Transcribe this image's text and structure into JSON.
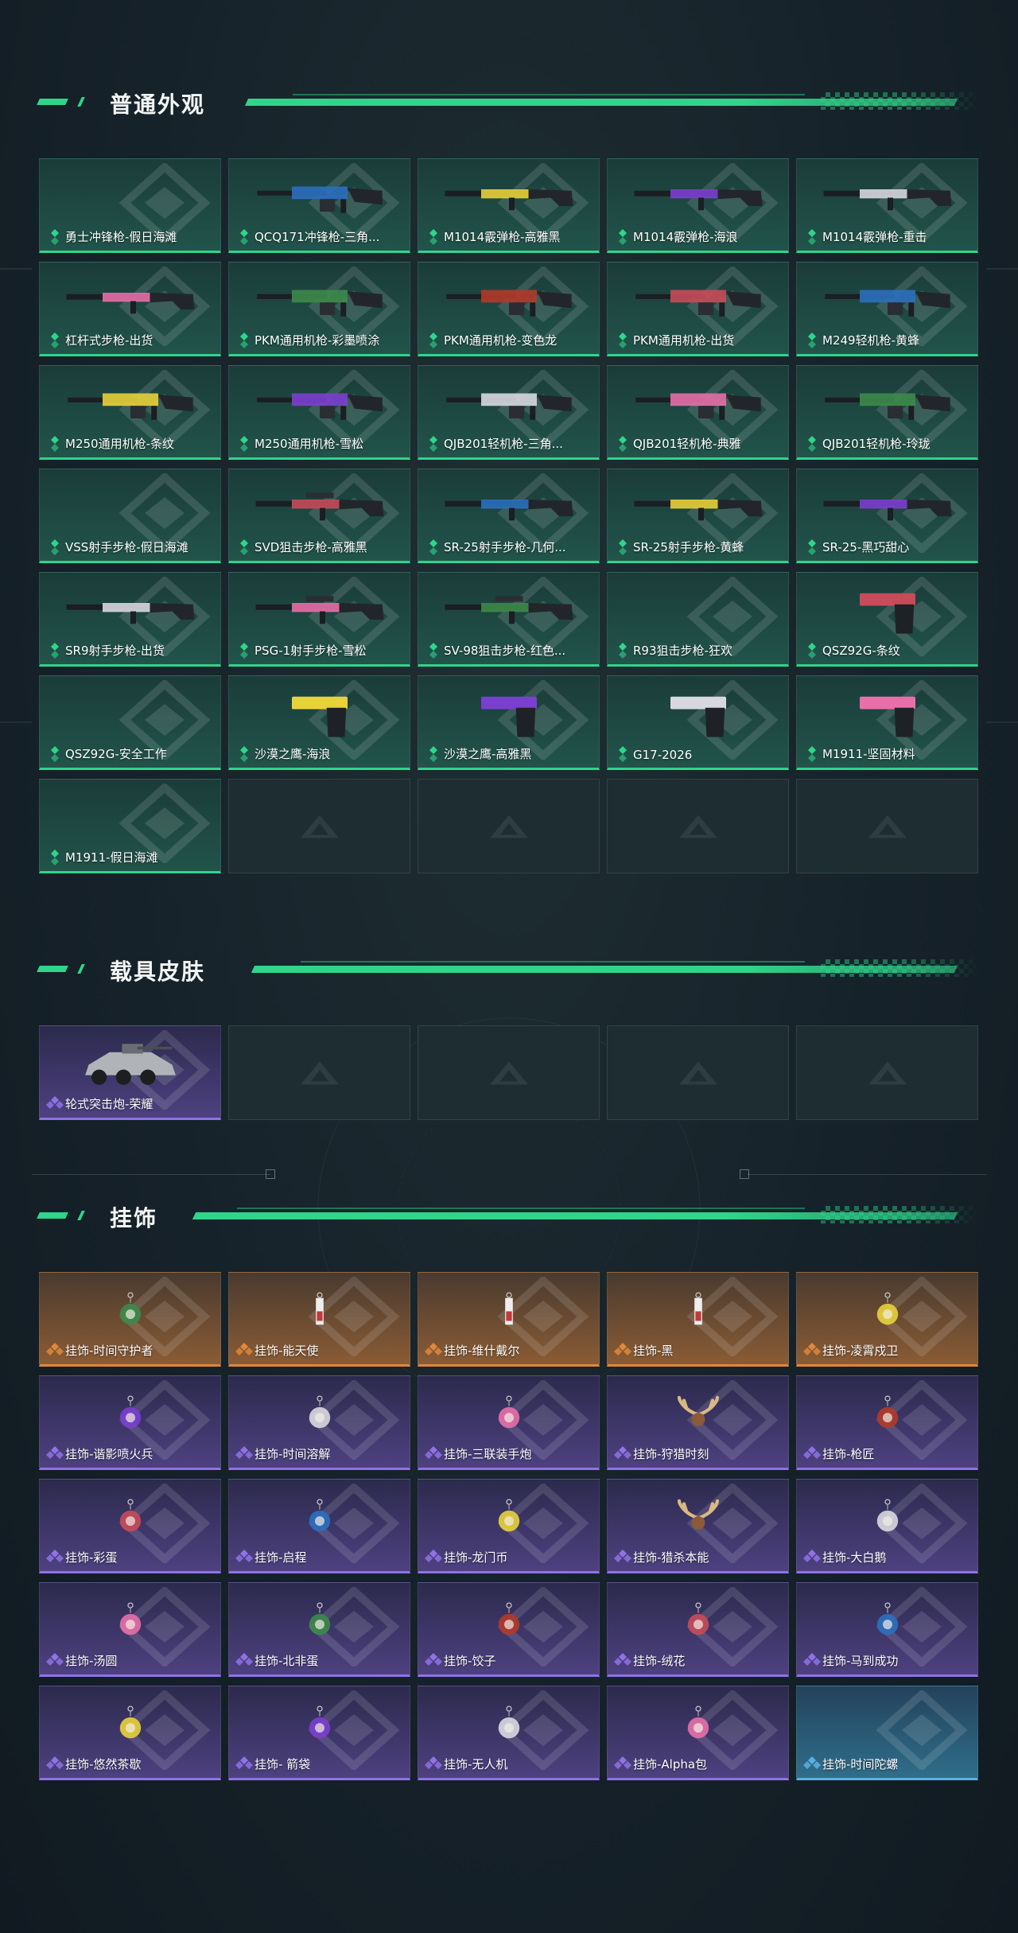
{
  "sections": [
    {
      "title": "普通外观",
      "items": [
        {
          "name": "勇士冲锋枪-假日海滩",
          "rarity": "green",
          "icon": "none"
        },
        {
          "name": "QCQ171冲锋枪-三角...",
          "rarity": "green",
          "icon": "smg-icon"
        },
        {
          "name": "M1014霰弹枪-高雅黑",
          "rarity": "green",
          "icon": "shotgun-icon"
        },
        {
          "name": "M1014霰弹枪-海浪",
          "rarity": "green",
          "icon": "shotgun-icon"
        },
        {
          "name": "M1014霰弹枪-重击",
          "rarity": "green",
          "icon": "shotgun-icon"
        },
        {
          "name": "杠杆式步枪-出货",
          "rarity": "green",
          "icon": "rifle-icon"
        },
        {
          "name": "PKM通用机枪-彩墨喷涂",
          "rarity": "green",
          "icon": "machine-gun-icon"
        },
        {
          "name": "PKM通用机枪-变色龙",
          "rarity": "green",
          "icon": "machine-gun-icon"
        },
        {
          "name": "PKM通用机枪-出货",
          "rarity": "green",
          "icon": "machine-gun-icon"
        },
        {
          "name": "M249轻机枪-黄蜂",
          "rarity": "green",
          "icon": "machine-gun-icon"
        },
        {
          "name": "M250通用机枪-条纹",
          "rarity": "green",
          "icon": "machine-gun-icon"
        },
        {
          "name": "M250通用机枪-雪松",
          "rarity": "green",
          "icon": "machine-gun-icon"
        },
        {
          "name": "QJB201轻机枪-三角...",
          "rarity": "green",
          "icon": "machine-gun-icon"
        },
        {
          "name": "QJB201轻机枪-典雅",
          "rarity": "green",
          "icon": "machine-gun-icon"
        },
        {
          "name": "QJB201轻机枪-玲珑",
          "rarity": "green",
          "icon": "machine-gun-icon"
        },
        {
          "name": "VSS射手步枪-假日海滩",
          "rarity": "green",
          "icon": "none"
        },
        {
          "name": "SVD狙击步枪-高雅黑",
          "rarity": "green",
          "icon": "sniper-icon"
        },
        {
          "name": "SR-25射手步枪-几何...",
          "rarity": "green",
          "icon": "rifle-icon"
        },
        {
          "name": "SR-25射手步枪-黄蜂",
          "rarity": "green",
          "icon": "rifle-icon"
        },
        {
          "name": "SR-25-黑巧甜心",
          "rarity": "green",
          "icon": "rifle-icon"
        },
        {
          "name": "SR9射手步枪-出货",
          "rarity": "green",
          "icon": "rifle-icon"
        },
        {
          "name": "PSG-1射手步枪-雪松",
          "rarity": "green",
          "icon": "sniper-icon"
        },
        {
          "name": "SV-98狙击步枪-红色...",
          "rarity": "green",
          "icon": "sniper-icon"
        },
        {
          "name": "R93狙击步枪-狂欢",
          "rarity": "green",
          "icon": "none"
        },
        {
          "name": "QSZ92G-条纹",
          "rarity": "green",
          "icon": "pistol-icon"
        },
        {
          "name": "QSZ92G-安全工作",
          "rarity": "green",
          "icon": "none"
        },
        {
          "name": "沙漠之鹰-海浪",
          "rarity": "green",
          "icon": "pistol-icon"
        },
        {
          "name": "沙漠之鹰-高雅黑",
          "rarity": "green",
          "icon": "pistol-icon"
        },
        {
          "name": "G17-2026",
          "rarity": "green",
          "icon": "pistol-icon"
        },
        {
          "name": "M1911-坚固材料",
          "rarity": "green",
          "icon": "pistol-icon"
        },
        {
          "name": "M1911-假日海滩",
          "rarity": "green",
          "icon": "none"
        },
        {
          "name": "",
          "rarity": "empty",
          "icon": "placeholder-logo-icon"
        },
        {
          "name": "",
          "rarity": "empty",
          "icon": "placeholder-logo-icon"
        },
        {
          "name": "",
          "rarity": "empty",
          "icon": "placeholder-logo-icon"
        },
        {
          "name": "",
          "rarity": "empty",
          "icon": "placeholder-logo-icon"
        }
      ]
    },
    {
      "title": "载具皮肤",
      "items": [
        {
          "name": "轮式突击炮-荣耀",
          "rarity": "purple",
          "icon": "vehicle-icon"
        },
        {
          "name": "",
          "rarity": "empty",
          "icon": "placeholder-logo-icon"
        },
        {
          "name": "",
          "rarity": "empty",
          "icon": "placeholder-logo-icon"
        },
        {
          "name": "",
          "rarity": "empty",
          "icon": "placeholder-logo-icon"
        },
        {
          "name": "",
          "rarity": "empty",
          "icon": "placeholder-logo-icon"
        }
      ]
    },
    {
      "title": "挂饰",
      "items": [
        {
          "name": "挂饰-时间守护者",
          "rarity": "orange",
          "icon": "charm-icon"
        },
        {
          "name": "挂饰-能天使",
          "rarity": "orange",
          "icon": "tag-charm-icon"
        },
        {
          "name": "挂饰-维什戴尔",
          "rarity": "orange",
          "icon": "tag-charm-icon"
        },
        {
          "name": "挂饰-黑",
          "rarity": "orange",
          "icon": "tag-charm-icon"
        },
        {
          "name": "挂饰-凌霄戍卫",
          "rarity": "orange",
          "icon": "charm-icon"
        },
        {
          "name": "挂饰-谐影喷火兵",
          "rarity": "purple",
          "icon": "charm-icon"
        },
        {
          "name": "挂饰-时间溶解",
          "rarity": "purple",
          "icon": "charm-icon"
        },
        {
          "name": "挂饰-三联装手炮",
          "rarity": "purple",
          "icon": "charm-icon"
        },
        {
          "name": "挂饰-狩猎时刻",
          "rarity": "purple",
          "icon": "antler-charm-icon"
        },
        {
          "name": "挂饰-枪匠",
          "rarity": "purple",
          "icon": "charm-icon"
        },
        {
          "name": "挂饰-彩蛋",
          "rarity": "purple",
          "icon": "charm-icon"
        },
        {
          "name": "挂饰-启程",
          "rarity": "purple",
          "icon": "charm-icon"
        },
        {
          "name": "挂饰-龙门币",
          "rarity": "purple",
          "icon": "charm-icon"
        },
        {
          "name": "挂饰-猎杀本能",
          "rarity": "purple",
          "icon": "antler-charm-icon"
        },
        {
          "name": "挂饰-大白鹅",
          "rarity": "purple",
          "icon": "charm-icon"
        },
        {
          "name": "挂饰-汤圆",
          "rarity": "purple",
          "icon": "charm-icon"
        },
        {
          "name": "挂饰-北非蛋",
          "rarity": "purple",
          "icon": "charm-icon"
        },
        {
          "name": "挂饰-饺子",
          "rarity": "purple",
          "icon": "charm-icon"
        },
        {
          "name": "挂饰-绒花",
          "rarity": "purple",
          "icon": "charm-icon"
        },
        {
          "name": "挂饰-马到成功",
          "rarity": "purple",
          "icon": "charm-icon"
        },
        {
          "name": "挂饰-悠然茶歇",
          "rarity": "purple",
          "icon": "charm-icon"
        },
        {
          "name": "挂饰- 箭袋",
          "rarity": "purple",
          "icon": "charm-icon"
        },
        {
          "name": "挂饰-无人机",
          "rarity": "purple",
          "icon": "charm-icon"
        },
        {
          "name": "挂饰-Alpha包",
          "rarity": "purple",
          "icon": "charm-icon"
        },
        {
          "name": "挂饰-时间陀螺",
          "rarity": "blue",
          "icon": "none"
        }
      ]
    }
  ],
  "colors": {
    "accent": "#2fd58a",
    "green": "#2fd58a",
    "purple": "#8f72e6",
    "orange": "#e0873b",
    "blue": "#5ab0e0"
  }
}
